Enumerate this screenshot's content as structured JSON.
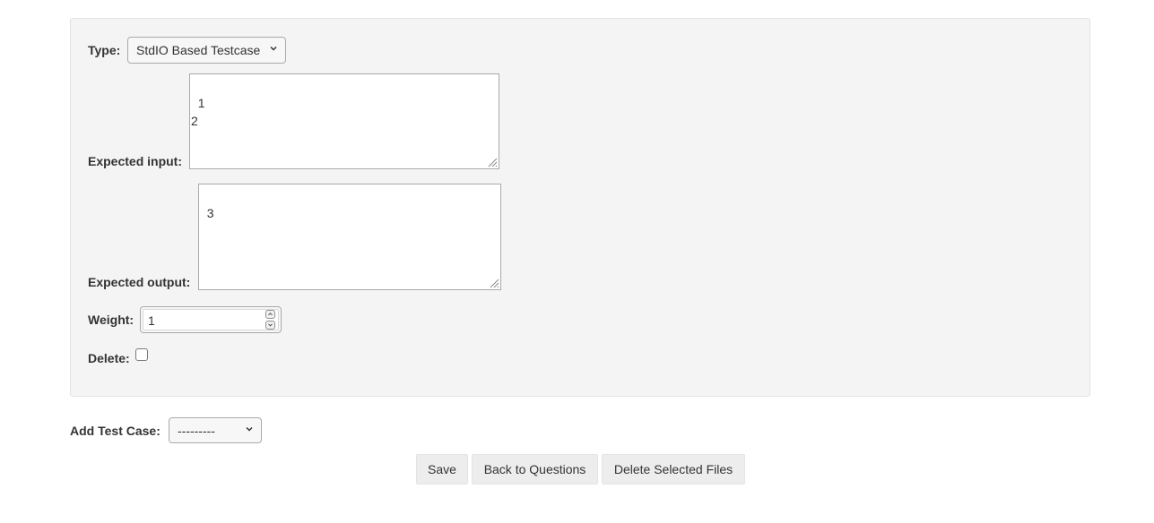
{
  "testcase": {
    "type_label": "Type:",
    "type_value": "StdIO Based Testcase",
    "expected_input_label": "Expected input:",
    "expected_input_value": "1\n2",
    "expected_output_label": "Expected output:",
    "expected_output_value": "3",
    "weight_label": "Weight:",
    "weight_value": "1",
    "delete_label": "Delete:",
    "delete_checked": false
  },
  "add_test_case": {
    "label": "Add Test Case:",
    "selected_value": "---------"
  },
  "actions": {
    "save_label": "Save",
    "back_label": "Back to Questions",
    "delete_files_label": "Delete Selected Files"
  },
  "icons": {
    "select_arrow": "chevron-down-icon",
    "spin_up": "chevron-up-icon",
    "spin_down": "chevron-down-icon",
    "resize": "resize-grip-icon"
  }
}
